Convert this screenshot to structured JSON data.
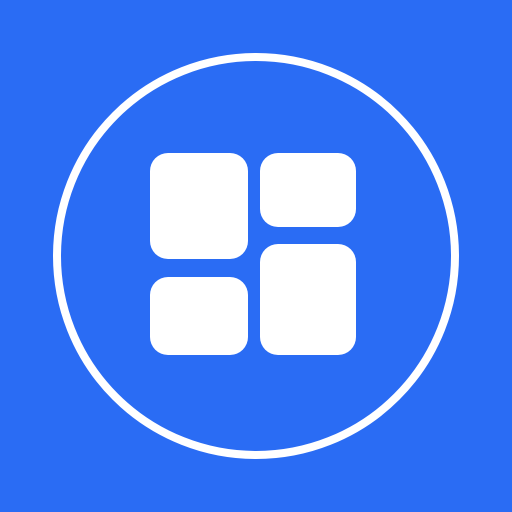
{
  "icon": {
    "name": "dashboard-grid-icon",
    "background_color": "#2A6CF4",
    "foreground_color": "#FFFFFF"
  }
}
